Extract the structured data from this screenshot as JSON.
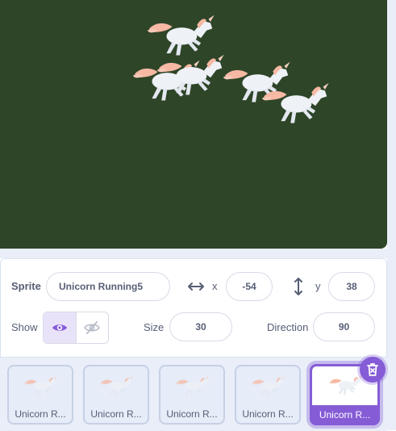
{
  "stage": {
    "background": "#2e4528",
    "sprite_icon": "unicorn-sprite"
  },
  "info": {
    "sprite_label": "Sprite",
    "sprite_name": "Unicorn Running5",
    "x_label": "x",
    "x_value": "-54",
    "y_label": "y",
    "y_value": "38",
    "show_label": "Show",
    "size_label": "Size",
    "size_value": "30",
    "direction_label": "Direction",
    "direction_value": "90"
  },
  "sprites": [
    {
      "label": "Unicorn R...",
      "selected": false
    },
    {
      "label": "Unicorn R...",
      "selected": false
    },
    {
      "label": "Unicorn R...",
      "selected": false
    },
    {
      "label": "Unicorn R...",
      "selected": false
    },
    {
      "label": "Unicorn R...",
      "selected": true
    }
  ],
  "colors": {
    "accent": "#855cd6",
    "text": "#575e75",
    "panel_bg": "#e9eef8"
  }
}
